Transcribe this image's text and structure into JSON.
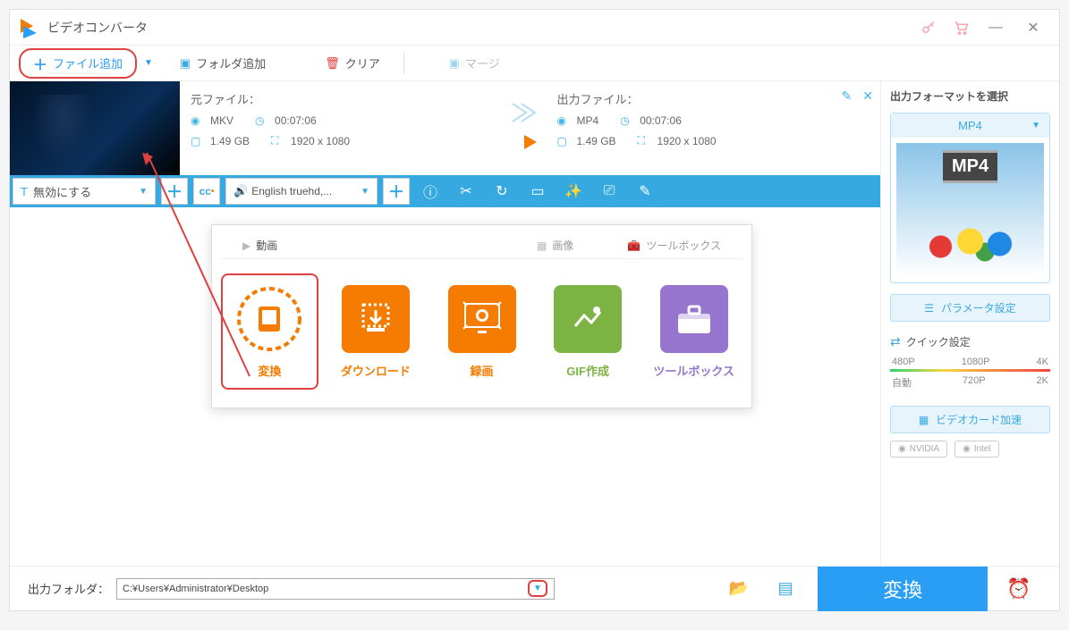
{
  "title": "ビデオコンバータ",
  "toolbar": {
    "add_file": "ファイル追加",
    "add_folder": "フォルダ追加",
    "clear": "クリア",
    "merge": "マージ"
  },
  "file": {
    "source_label": "元ファイル：",
    "output_label": "出力ファイル：",
    "source": {
      "format": "MKV",
      "duration": "00:07:06",
      "size": "1.49 GB",
      "resolution": "1920 x 1080"
    },
    "output": {
      "format": "MP4",
      "duration": "00:07:06",
      "size": "1.49 GB",
      "resolution": "1920 x 1080"
    }
  },
  "editbar": {
    "subtitle": "無効にする",
    "audio": "English truehd,..."
  },
  "panel": {
    "tabs": {
      "video": "動画",
      "image": "画像",
      "toolbox": "ツールボックス"
    },
    "cards": {
      "convert": "変換",
      "download": "ダウンロード",
      "record": "録画",
      "gif": "GIF作成",
      "toolbox": "ツールボックス"
    }
  },
  "right": {
    "title": "出力フォーマットを選択",
    "format": "MP4",
    "format_badge": "MP4",
    "param_settings": "パラメータ設定",
    "quick_settings": "クイック設定",
    "res": {
      "r480": "480P",
      "r1080": "1080P",
      "r4k": "4K",
      "auto": "自動",
      "r720": "720P",
      "r2k": "2K"
    },
    "gpu_accel": "ビデオカード加速",
    "nvidia": "NVIDIA",
    "intel": "Intel"
  },
  "bottom": {
    "label": "出力フォルダ：",
    "path": "C:¥Users¥Administrator¥Desktop",
    "convert": "変換"
  }
}
